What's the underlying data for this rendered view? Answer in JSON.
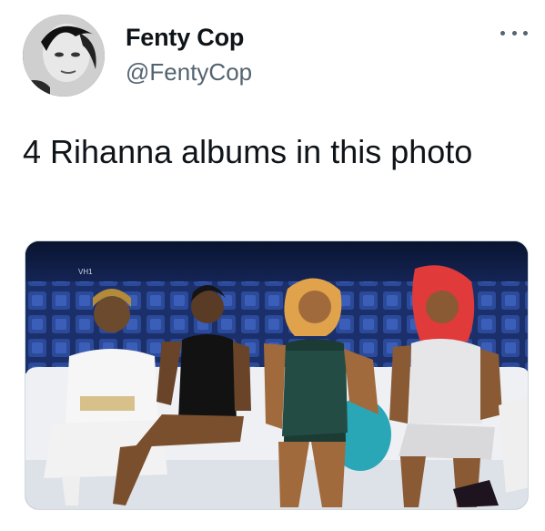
{
  "tweet": {
    "author": {
      "display_name": "Fenty Cop",
      "handle": "@FentyCop",
      "avatar_icon": "profile-photo"
    },
    "more_icon": "ellipsis-icon",
    "text": "4 Rihanna albums in this photo",
    "media": {
      "watermark": "VH1",
      "description_icon": "tv-show-photo"
    }
  },
  "colors": {
    "text": "#0f1419",
    "secondary_text": "#536471",
    "border": "#cfd9de"
  }
}
